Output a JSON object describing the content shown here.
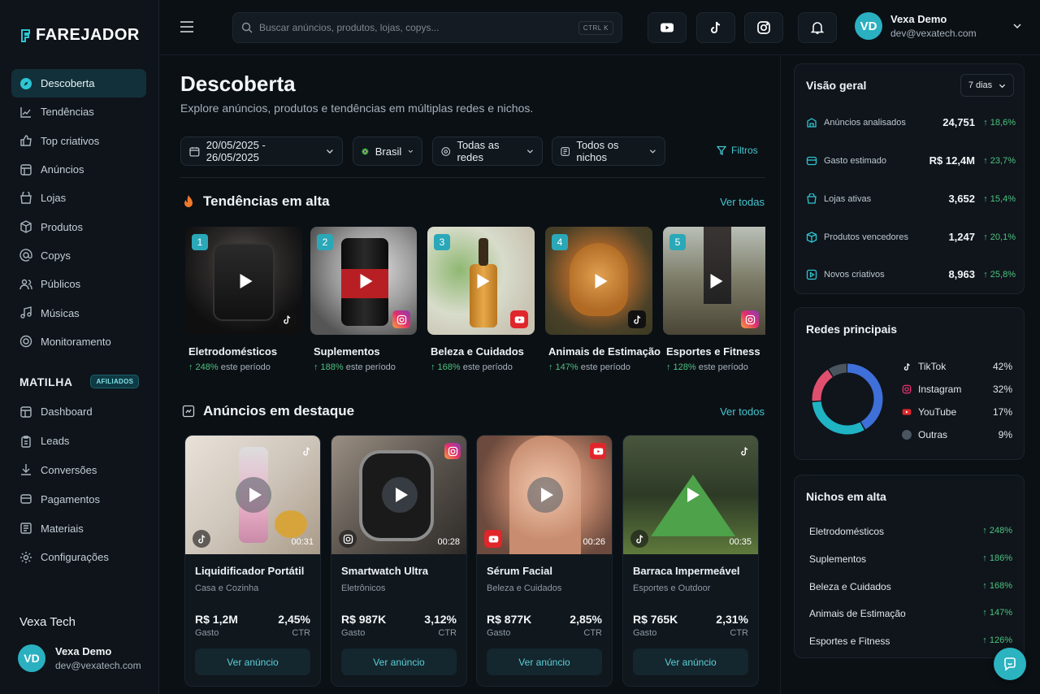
{
  "brand": {
    "name": "FAREJADOR"
  },
  "nav": [
    {
      "label": "Descoberta",
      "icon": "compass-icon",
      "active": true
    },
    {
      "label": "Tendências",
      "icon": "trend-chart-icon"
    },
    {
      "label": "Top criativos",
      "icon": "thumb-up-icon"
    },
    {
      "label": "Anúncios",
      "icon": "ads-grid-icon"
    },
    {
      "label": "Lojas",
      "icon": "store-icon"
    },
    {
      "label": "Produtos",
      "icon": "package-icon"
    },
    {
      "label": "Copys",
      "icon": "at-sign-icon"
    },
    {
      "label": "Públicos",
      "icon": "users-icon"
    },
    {
      "label": "Músicas",
      "icon": "music-note-icon"
    },
    {
      "label": "Monitoramento",
      "icon": "target-icon"
    }
  ],
  "affiliate": {
    "title": "MATILHA",
    "badge": "AFILIADOS"
  },
  "nav2": [
    {
      "label": "Dashboard",
      "icon": "dashboard-icon"
    },
    {
      "label": "Leads",
      "icon": "clipboard-icon"
    },
    {
      "label": "Conversões",
      "icon": "conversion-icon"
    },
    {
      "label": "Pagamentos",
      "icon": "payment-icon"
    },
    {
      "label": "Materiais",
      "icon": "folder-icon"
    },
    {
      "label": "Configurações",
      "icon": "gear-icon"
    }
  ],
  "sidebar_user": {
    "org": "Vexa Tech",
    "initials": "VD",
    "name": "Vexa Demo",
    "email": "dev@vexatech.com"
  },
  "topbar": {
    "search_placeholder": "Buscar anúncios, produtos, lojas, copys...",
    "shortcut": "CTRL  K",
    "user_initials": "VD",
    "user_name": "Vexa Demo",
    "user_email": "dev@vexatech.com"
  },
  "page": {
    "title": "Descoberta",
    "subtitle": "Explore anúncios, produtos e tendências em múltiplas redes e nichos."
  },
  "filters": {
    "date": "20/05/2025 - 26/05/2025",
    "country": "Brasil",
    "network": "Todas as redes",
    "niche": "Todos os nichos",
    "more": "Filtros"
  },
  "trends": {
    "title": "Tendências em alta",
    "see_all": "Ver todas",
    "items": [
      {
        "num": "1",
        "name": "Eletrodomésticos",
        "growth": "↑ 248%",
        "period": "este período",
        "platform": "tiktok"
      },
      {
        "num": "2",
        "name": "Suplementos",
        "growth": "↑ 188%",
        "period": "este período",
        "platform": "instagram"
      },
      {
        "num": "3",
        "name": "Beleza e Cuidados",
        "growth": "↑ 168%",
        "period": "este período",
        "platform": "youtube"
      },
      {
        "num": "4",
        "name": "Animais de Estimação",
        "growth": "↑ 147%",
        "period": "este período",
        "platform": "tiktok"
      },
      {
        "num": "5",
        "name": "Esportes e Fitness",
        "growth": "↑ 128%",
        "period": "este período",
        "platform": "instagram"
      }
    ]
  },
  "featured": {
    "title": "Anúncios em destaque",
    "see_all": "Ver todos",
    "items": [
      {
        "title": "Liquidificador Portátil",
        "category": "Casa e Cozinha",
        "spend": "R$ 1,2M",
        "spend_label": "Gasto",
        "ctr": "2,45%",
        "ctr_label": "CTR",
        "duration": "00:31",
        "button": "Ver anúncio"
      },
      {
        "title": "Smartwatch Ultra",
        "category": "Eletrônicos",
        "spend": "R$ 987K",
        "spend_label": "Gasto",
        "ctr": "3,12%",
        "ctr_label": "CTR",
        "duration": "00:28",
        "button": "Ver anúncio"
      },
      {
        "title": "Sérum Facial",
        "category": "Beleza e Cuidados",
        "spend": "R$ 877K",
        "spend_label": "Gasto",
        "ctr": "2,85%",
        "ctr_label": "CTR",
        "duration": "00:26",
        "button": "Ver anúncio"
      },
      {
        "title": "Barraca Impermeável",
        "category": "Esportes e Outdoor",
        "spend": "R$ 765K",
        "spend_label": "Gasto",
        "ctr": "2,31%",
        "ctr_label": "CTR",
        "duration": "00:35",
        "button": "Ver anúncio"
      }
    ]
  },
  "overview": {
    "title": "Visão geral",
    "period": "7 dias",
    "kpis": [
      {
        "label": "Anúncios analisados",
        "value": "24,751",
        "growth": "↑ 18,6%"
      },
      {
        "label": "Gasto estimado",
        "value": "R$ 12,4M",
        "growth": "↑ 23,7%"
      },
      {
        "label": "Lojas ativas",
        "value": "3,652",
        "growth": "↑ 15,4%"
      },
      {
        "label": "Produtos vencedores",
        "value": "1,247",
        "growth": "↑ 20,1%"
      },
      {
        "label": "Novos criativos",
        "value": "8,963",
        "growth": "↑ 25,8%"
      }
    ]
  },
  "networks": {
    "title": "Redes principais",
    "items": [
      {
        "name": "TikTok",
        "pct": "42%",
        "value": 42,
        "color": "#3f6fd8"
      },
      {
        "name": "Instagram",
        "pct": "32%",
        "value": 32,
        "color": "#1fb3c4"
      },
      {
        "name": "YouTube",
        "pct": "17%",
        "value": 17,
        "color": "#e0506e"
      },
      {
        "name": "Outras",
        "pct": "9%",
        "value": 9,
        "color": "#4a5560"
      }
    ]
  },
  "niches": {
    "title": "Nichos em alta",
    "items": [
      {
        "name": "Eletrodomésticos",
        "growth": "↑ 248%"
      },
      {
        "name": "Suplementos",
        "growth": "↑ 186%"
      },
      {
        "name": "Beleza e Cuidados",
        "growth": "↑ 168%"
      },
      {
        "name": "Animais de Estimação",
        "growth": "↑ 147%"
      },
      {
        "name": "Esportes e Fitness",
        "growth": "↑ 126%"
      }
    ]
  }
}
